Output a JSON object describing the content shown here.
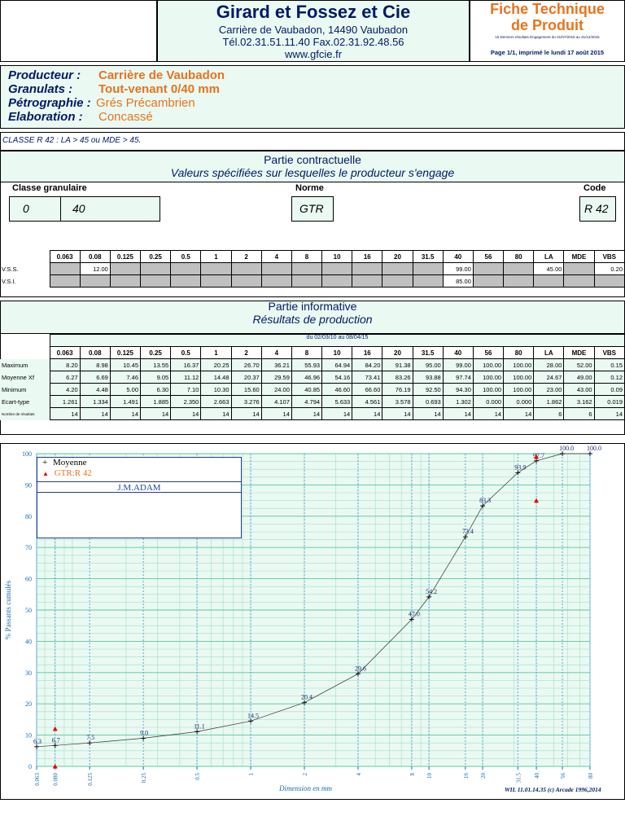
{
  "header": {
    "company": "Girard et Fossez et Cie",
    "address": "Carrière de Vaubadon,   14490 Vaubadon",
    "phone_fax": "Tél.02.31.51.11.40     Fax.02.31.92.48.56",
    "website": "www.gfcie.fr",
    "doc_title_line1": "Fiche Technique",
    "doc_title_line2": "de Produit",
    "engagement": "15 Derniers résultats Engagement du 01/07/2015 au 31/12/2015",
    "page_info": "Page 1/1, imprimé le lundi 17 août 2015"
  },
  "product": {
    "producteur_label": "Producteur :",
    "producteur": "Carrière de Vaubadon",
    "granulats_label": "Granulats :",
    "granulats": "Tout-venant 0/40 mm",
    "petro_label": "Pétrographie :",
    "petro": "Grés Précambrien",
    "elab_label": "Elaboration :",
    "elab": "Concassé"
  },
  "classe_line": "CLASSE R 42 : LA > 45 ou MDE > 45.",
  "contract": {
    "title": "Partie contractuelle",
    "subtitle": "Valeurs spécifiées sur lesquelles le producteur s'engage",
    "classe_label": "Classe  granulaire",
    "norme_label": "Norme",
    "code_label": "Code",
    "d_min": "0",
    "d_max": "40",
    "norme": "GTR",
    "code": "R 42"
  },
  "columns": [
    "0.063",
    "0.08",
    "0.125",
    "0.25",
    "0.5",
    "1",
    "2",
    "4",
    "8",
    "10",
    "16",
    "20",
    "31.5",
    "40",
    "56",
    "80",
    "LA",
    "MDE",
    "VBS"
  ],
  "vss": {
    "label": "V.S.S.",
    "cells": [
      "",
      "12.00",
      "",
      "",
      "",
      "",
      "",
      "",
      "",
      "",
      "",
      "",
      "",
      "99.00",
      "",
      "",
      "45.00",
      "",
      "0.20"
    ]
  },
  "vsi": {
    "label": "V.S.I.",
    "cells": [
      "",
      "",
      "",
      "",
      "",
      "",
      "",
      "",
      "",
      "",
      "",
      "",
      "",
      "85.00",
      "",
      "",
      "",
      "",
      ""
    ]
  },
  "info": {
    "title": "Partie informative",
    "subtitle": "Résultats de production",
    "period": "du 02/03/10 au 08/04/15"
  },
  "results": [
    {
      "label": "Maximum",
      "cells": [
        "8.20",
        "8.98",
        "10.45",
        "13.55",
        "16.37",
        "20.25",
        "26.70",
        "36.21",
        "55.93",
        "64.94",
        "84.20",
        "91.38",
        "95.00",
        "99.00",
        "100.00",
        "100.00",
        "28.00",
        "52.00",
        "0.15"
      ]
    },
    {
      "label": "Moyenne Xf",
      "cells": [
        "6.27",
        "6.69",
        "7.46",
        "9.05",
        "11.12",
        "14.48",
        "20.37",
        "29.59",
        "46.96",
        "54.16",
        "73.41",
        "83.26",
        "93.88",
        "97.74",
        "100.00",
        "100.00",
        "24.67",
        "49.00",
        "0.12"
      ]
    },
    {
      "label": "Minimum",
      "cells": [
        "4.20",
        "4.48",
        "5.00",
        "6.30",
        "7.10",
        "10.30",
        "15.60",
        "24.00",
        "40.85",
        "46.60",
        "66.60",
        "76.19",
        "92.50",
        "94.30",
        "100.00",
        "100.00",
        "23.00",
        "43.00",
        "0.09"
      ]
    },
    {
      "label": "Ecart-type",
      "cells": [
        "1.261",
        "1.334",
        "1.491",
        "1.885",
        "2.350",
        "2.663",
        "3.276",
        "4.107",
        "4.794",
        "5.633",
        "4.561",
        "3.578",
        "0.693",
        "1.302",
        "0.000",
        "0.000",
        "1.862",
        "3.162",
        "0.019"
      ]
    },
    {
      "label": "Nombre de résultats",
      "cells": [
        "14",
        "14",
        "14",
        "14",
        "14",
        "14",
        "14",
        "14",
        "14",
        "14",
        "14",
        "14",
        "14",
        "14",
        "14",
        "14",
        "6",
        "6",
        "14"
      ]
    }
  ],
  "chart_data": {
    "type": "line",
    "ylabel": "% Passants cumulés",
    "xlabel": "Dimension en mm",
    "ylim": [
      0,
      100
    ],
    "yticks": [
      0,
      10,
      20,
      30,
      40,
      50,
      60,
      70,
      80,
      90,
      100
    ],
    "xscale": "log",
    "xticks": [
      "0.063",
      "0.080",
      "0.125",
      "0.25",
      "0.5",
      "1",
      "2",
      "4",
      "8",
      "10",
      "16",
      "20",
      "31.5",
      "40",
      "56",
      "80"
    ],
    "series": [
      {
        "name": "Moyenne",
        "x": [
          0.063,
          0.08,
          0.125,
          0.25,
          0.5,
          1,
          2,
          4,
          8,
          10,
          16,
          20,
          31.5,
          40,
          56,
          80
        ],
        "values": [
          6.3,
          6.7,
          7.5,
          9.0,
          11.1,
          14.5,
          20.4,
          29.6,
          47.0,
          54.2,
          73.4,
          83.3,
          93.9,
          97.7,
          100.0,
          100.0
        ],
        "labels": [
          "6.3",
          "6.7",
          "7.5",
          "9.0",
          "11.1",
          "14.5",
          "20.4",
          "29.6",
          "47.0",
          "54.2",
          "73.4",
          "83.3",
          "93.9",
          "97.7",
          "100.0",
          "100.0"
        ]
      },
      {
        "name": "GTR:R 42",
        "x": [
          0.08,
          0.08,
          40,
          40
        ],
        "values": [
          12,
          0,
          99,
          85
        ],
        "color": "#e00000"
      }
    ],
    "legend_box_text": "J.M.ADAM",
    "grid": true,
    "legend": "top-left",
    "credit": "WIL 11.01.14.35 (c) Arcade 1996,2014"
  }
}
